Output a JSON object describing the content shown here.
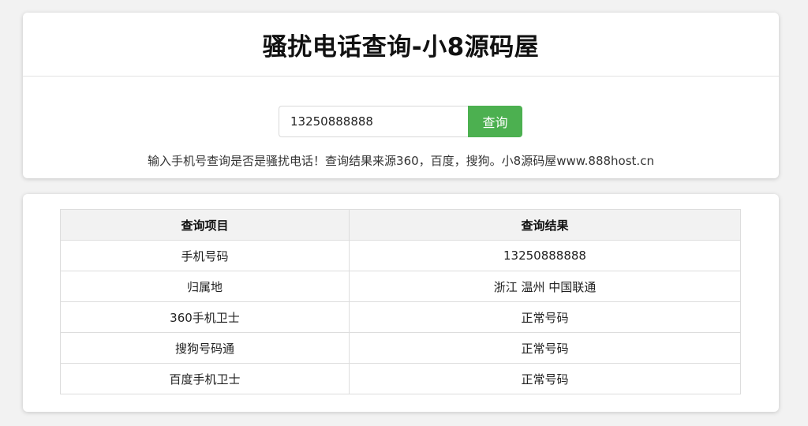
{
  "header": {
    "title": "骚扰电话查询-小8源码屋"
  },
  "search": {
    "value": "13250888888",
    "button_label": "查询",
    "hint": "输入手机号查询是否是骚扰电话！查询结果来源360，百度，搜狗。小8源码屋www.888host.cn"
  },
  "accent_color": "#4cb050",
  "results": {
    "columns": [
      "查询项目",
      "查询结果"
    ],
    "rows": [
      {
        "item": "手机号码",
        "result": "13250888888"
      },
      {
        "item": "归属地",
        "result": "浙江 温州 中国联通"
      },
      {
        "item": "360手机卫士",
        "result": "正常号码"
      },
      {
        "item": "搜狗号码通",
        "result": "正常号码"
      },
      {
        "item": "百度手机卫士",
        "result": "正常号码"
      }
    ]
  }
}
